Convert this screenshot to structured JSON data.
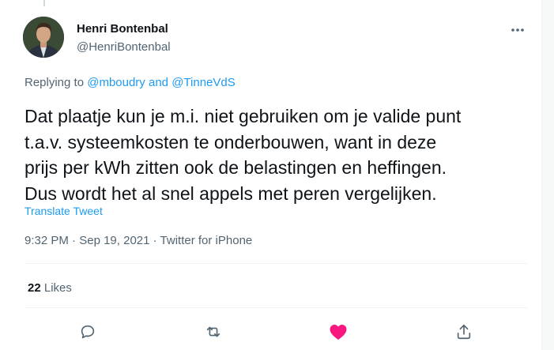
{
  "tweet": {
    "author": {
      "display_name": "Henri Bontenbal",
      "handle": "@HenriBontenbal"
    },
    "replying": {
      "prefix": "Replying to",
      "user1": "@mboudry",
      "conj": "and",
      "user2": "@TinneVdS"
    },
    "text_lines": [
      "Dat plaatje kun je m.i. niet gebruiken om je valide punt",
      "t.a.v. systeemkosten te onderbouwen, want in deze",
      "prijs per kWh zitten ook de belastingen en heffingen.",
      "Dus wordt het al snel appels met peren vergelijken."
    ],
    "translate_label": "Translate Tweet",
    "time": "9:32 PM",
    "sep1": "·",
    "date": "Sep 19, 2021",
    "sep2": "·",
    "source": "Twitter for iPhone",
    "likes_count": "22",
    "likes_label": "Likes"
  },
  "icons": {
    "more": "more-horizontal-icon",
    "reply": "reply-icon",
    "retweet": "retweet-icon",
    "like": "heart-filled-icon",
    "share": "share-icon"
  },
  "colors": {
    "accent": "#1d9bf0",
    "like": "#f91880",
    "text_primary": "#0f1419",
    "text_secondary": "#536471"
  }
}
